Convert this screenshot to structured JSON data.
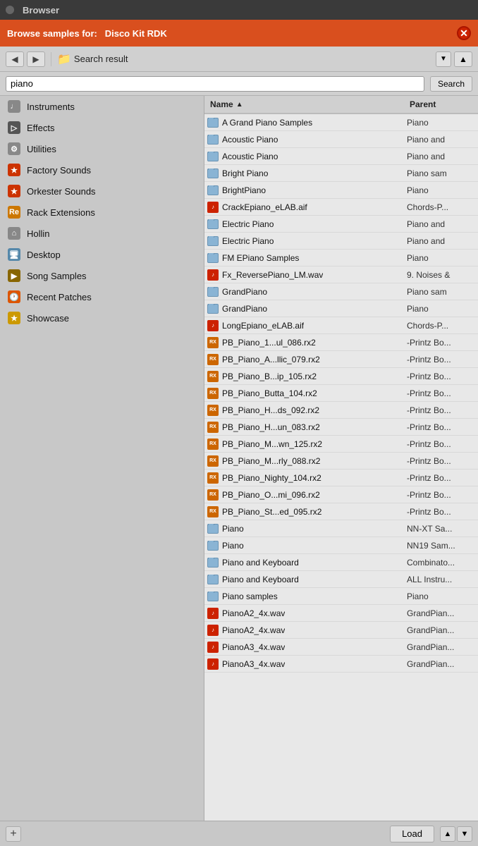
{
  "titleBar": {
    "title": "Browser"
  },
  "orangeHeader": {
    "label": "Browse samples for:",
    "target": "Disco Kit RDK"
  },
  "navBar": {
    "location": "Search result",
    "backLabel": "◀",
    "forwardLabel": "▶",
    "upLabel": "▲"
  },
  "search": {
    "value": "piano",
    "placeholder": "piano",
    "buttonLabel": "Search"
  },
  "columns": {
    "nameLabel": "Name",
    "parentLabel": "Parent"
  },
  "sidebar": {
    "items": [
      {
        "id": "instruments",
        "label": "Instruments",
        "icon": "♩",
        "iconClass": "icon-instruments"
      },
      {
        "id": "effects",
        "label": "Effects",
        "icon": "▷",
        "iconClass": "icon-effects"
      },
      {
        "id": "utilities",
        "label": "Utilities",
        "icon": "⚙",
        "iconClass": "icon-utilities"
      },
      {
        "id": "factory-sounds",
        "label": "Factory Sounds",
        "icon": "★",
        "iconClass": "icon-factory"
      },
      {
        "id": "orkester-sounds",
        "label": "Orkester Sounds",
        "icon": "★",
        "iconClass": "icon-orkester"
      },
      {
        "id": "rack-extensions",
        "label": "Rack Extensions",
        "icon": "Re",
        "iconClass": "icon-rack"
      },
      {
        "id": "hollin",
        "label": "Hollin",
        "icon": "⌂",
        "iconClass": "icon-hollin"
      },
      {
        "id": "desktop",
        "label": "Desktop",
        "icon": "🖥",
        "iconClass": "icon-desktop"
      },
      {
        "id": "song-samples",
        "label": "Song Samples",
        "icon": "▶",
        "iconClass": "icon-song"
      },
      {
        "id": "recent-patches",
        "label": "Recent Patches",
        "icon": "🕐",
        "iconClass": "icon-recent"
      },
      {
        "id": "showcase",
        "label": "Showcase",
        "icon": "★",
        "iconClass": "icon-showcase"
      }
    ]
  },
  "files": [
    {
      "name": "A Grand Piano Samples",
      "parent": "Piano",
      "type": "folder"
    },
    {
      "name": "Acoustic Piano",
      "parent": "Piano and",
      "type": "folder"
    },
    {
      "name": "Acoustic Piano",
      "parent": "Piano and",
      "type": "folder"
    },
    {
      "name": "Bright Piano",
      "parent": "Piano sam",
      "type": "folder"
    },
    {
      "name": "BrightPiano",
      "parent": "Piano",
      "type": "folder"
    },
    {
      "name": "CrackEpiano_eLAB.aif",
      "parent": "Chords-P...",
      "type": "audio"
    },
    {
      "name": "Electric Piano",
      "parent": "Piano and",
      "type": "folder"
    },
    {
      "name": "Electric Piano",
      "parent": "Piano and",
      "type": "folder"
    },
    {
      "name": "FM EPiano Samples",
      "parent": "Piano",
      "type": "folder"
    },
    {
      "name": "Fx_ReversePiano_LM.wav",
      "parent": "9. Noises &",
      "type": "audio"
    },
    {
      "name": "GrandPiano",
      "parent": "Piano sam",
      "type": "folder"
    },
    {
      "name": "GrandPiano",
      "parent": "Piano",
      "type": "folder"
    },
    {
      "name": "LongEpiano_eLAB.aif",
      "parent": "Chords-P...",
      "type": "audio"
    },
    {
      "name": "PB_Piano_1...ul_086.rx2",
      "parent": "-Printz Bo...",
      "type": "rx2"
    },
    {
      "name": "PB_Piano_A...llic_079.rx2",
      "parent": "-Printz Bo...",
      "type": "rx2"
    },
    {
      "name": "PB_Piano_B...ip_105.rx2",
      "parent": "-Printz Bo...",
      "type": "rx2"
    },
    {
      "name": "PB_Piano_Butta_104.rx2",
      "parent": "-Printz Bo...",
      "type": "rx2"
    },
    {
      "name": "PB_Piano_H...ds_092.rx2",
      "parent": "-Printz Bo...",
      "type": "rx2"
    },
    {
      "name": "PB_Piano_H...un_083.rx2",
      "parent": "-Printz Bo...",
      "type": "rx2"
    },
    {
      "name": "PB_Piano_M...wn_125.rx2",
      "parent": "-Printz Bo...",
      "type": "rx2"
    },
    {
      "name": "PB_Piano_M...rly_088.rx2",
      "parent": "-Printz Bo...",
      "type": "rx2"
    },
    {
      "name": "PB_Piano_Nighty_104.rx2",
      "parent": "-Printz Bo...",
      "type": "rx2"
    },
    {
      "name": "PB_Piano_O...mi_096.rx2",
      "parent": "-Printz Bo...",
      "type": "rx2"
    },
    {
      "name": "PB_Piano_St...ed_095.rx2",
      "parent": "-Printz Bo...",
      "type": "rx2"
    },
    {
      "name": "Piano",
      "parent": "NN-XT Sa...",
      "type": "folder"
    },
    {
      "name": "Piano",
      "parent": "NN19 Sam...",
      "type": "folder"
    },
    {
      "name": "Piano and Keyboard",
      "parent": "Combinato...",
      "type": "folder"
    },
    {
      "name": "Piano and Keyboard",
      "parent": "ALL Instru...",
      "type": "folder"
    },
    {
      "name": "Piano samples",
      "parent": "Piano",
      "type": "folder"
    },
    {
      "name": "PianoA2_4x.wav",
      "parent": "GrandPian...",
      "type": "audio"
    },
    {
      "name": "PianoA2_4x.wav",
      "parent": "GrandPian...",
      "type": "audio"
    },
    {
      "name": "PianoA3_4x.wav",
      "parent": "GrandPian...",
      "type": "audio"
    },
    {
      "name": "PianoA3_4x.wav",
      "parent": "GrandPian...",
      "type": "audio"
    }
  ],
  "bottomBar": {
    "addLabel": "+",
    "loadLabel": "Load",
    "upArrow": "▲",
    "downArrow": "▼"
  }
}
